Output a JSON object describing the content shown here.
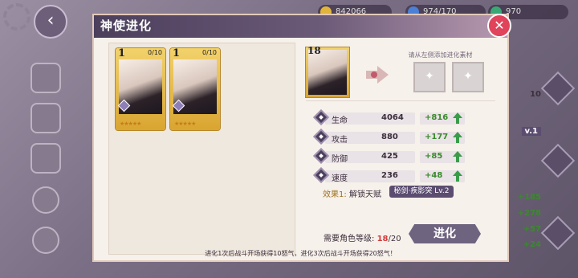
{
  "background": {
    "resources": [
      {
        "value": "842066",
        "icon": "gold-coin-icon",
        "color": "#e2b53a"
      },
      {
        "value": "974/170",
        "icon": "stamina-icon",
        "color": "#4c7fd6"
      },
      {
        "value": "970",
        "icon": "gem-icon",
        "color": "#3aa874"
      }
    ],
    "right_stats": [
      "10",
      "v.1",
      "+185",
      "+278",
      "+57",
      "+24"
    ]
  },
  "modal": {
    "title": "神使进化",
    "close_icon": "close-icon",
    "material_cards": [
      {
        "level": "1",
        "count": "0/10",
        "stars": "★★★★★"
      },
      {
        "level": "1",
        "count": "0/10",
        "stars": "★★★★★"
      }
    ],
    "target_card": {
      "level": "18"
    },
    "hint": "请从左侧添加进化素材",
    "stats": [
      {
        "name": "生命",
        "value": "4064",
        "gain": "+816"
      },
      {
        "name": "攻击",
        "value": "880",
        "gain": "+177"
      },
      {
        "name": "防御",
        "value": "425",
        "gain": "+85"
      },
      {
        "name": "速度",
        "value": "236",
        "gain": "+48"
      }
    ],
    "effect": {
      "label": "效果1:",
      "text": "解锁天赋",
      "skill": "秘剑·疾影突 Lv.2"
    },
    "requirement": {
      "label": "需要角色等级:",
      "current": "18",
      "required": "/20"
    },
    "evolve_button": "进化",
    "footer_note": "进化1次后战斗开场获得10怒气，进化3次后战斗开场获得20怒气！",
    "colors": {
      "accent": "#4b3f5c",
      "gain": "#3a8a2c",
      "warning": "#d23b3b"
    }
  }
}
